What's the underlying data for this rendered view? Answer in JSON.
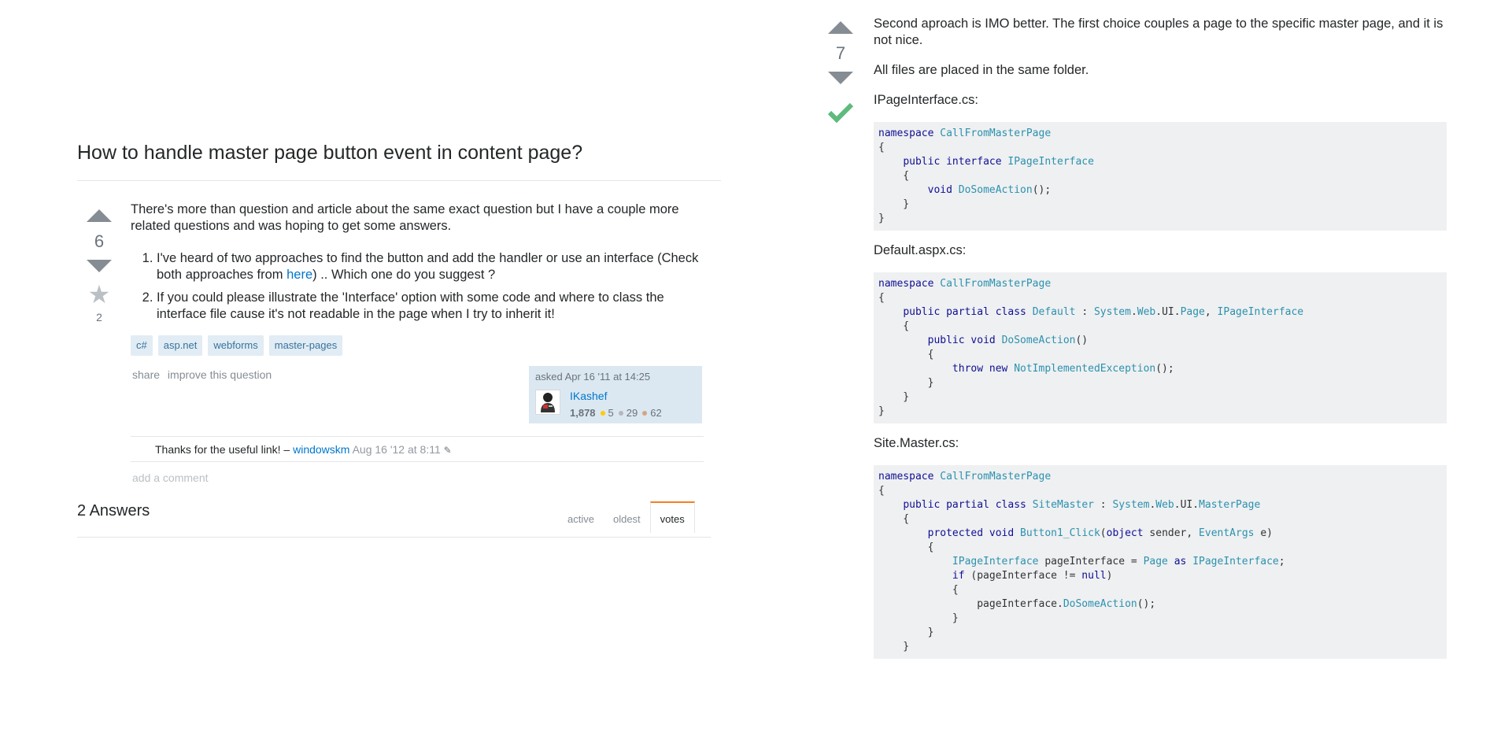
{
  "question": {
    "title": "How to handle master page button event in content page?",
    "votes": "6",
    "favorites": "2",
    "intro": "There's more than question and article about the same exact question but I have a couple more related questions and was hoping to get some answers.",
    "list": [
      {
        "before": "I've heard of two approaches to find the button and add the handler or use an interface (Check both approaches from ",
        "link": "here",
        "after": ") .. Which one do you suggest ?"
      },
      {
        "text": "If you could please illustrate the 'Interface' option with some code and where to class the interface file cause it's not readable in the page when I try to inherit it!"
      }
    ],
    "tags": [
      "c#",
      "asp.net",
      "webforms",
      "master-pages"
    ],
    "menu": {
      "share": "share",
      "improve": "improve this question"
    },
    "owner": {
      "asked": "asked Apr 16 '11 at 14:25",
      "name": "IKashef",
      "reputation": "1,878",
      "gold": "5",
      "silver": "29",
      "bronze": "62",
      "badge_colors": {
        "gold": "#ffcc01",
        "silver": "#b4b8bc",
        "bronze": "#d1a684"
      }
    },
    "comment": {
      "text": "Thanks for the useful link! –",
      "user": "windowskm",
      "date": "Aug 16 '12 at 8:11",
      "edit_icon": "pencil-icon"
    },
    "add_comment": "add a comment"
  },
  "answers_section": {
    "count_label": "2 Answers",
    "tabs": [
      "active",
      "oldest",
      "votes"
    ],
    "active_tab": "votes"
  },
  "answer": {
    "votes": "7",
    "accepted": true,
    "p1": "Second aproach is IMO better. The first choice couples a page to the specific master page, and it is not nice.",
    "p2": "All files are placed in the same folder.",
    "file1": "IPageInterface.cs:",
    "file2": "Default.aspx.cs:",
    "file3": "Site.Master.cs:"
  },
  "colors": {
    "accent": "#07c",
    "accepted": "#5eba7d",
    "tag_bg": "#e1ecf4",
    "tag_text": "#39739d"
  }
}
